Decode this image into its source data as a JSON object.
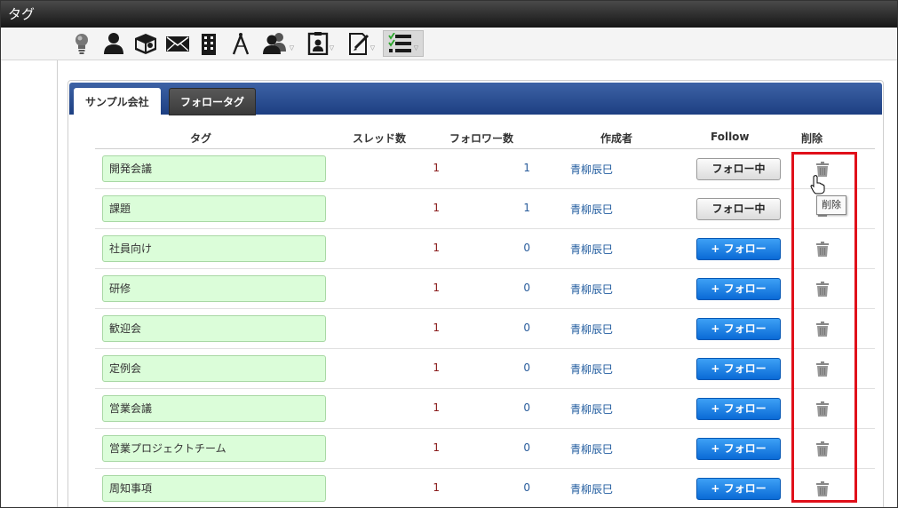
{
  "window": {
    "title": "タグ"
  },
  "toolbar": {
    "icons": [
      {
        "name": "lightbulb-icon"
      },
      {
        "name": "user-icon"
      },
      {
        "name": "package-icon"
      },
      {
        "name": "mail-icon"
      },
      {
        "name": "building-icon"
      },
      {
        "name": "compass-icon"
      },
      {
        "name": "users-icon",
        "dropdown": true
      },
      {
        "name": "clipboard-user-icon",
        "dropdown": true
      },
      {
        "name": "document-edit-icon",
        "dropdown": true
      },
      {
        "name": "checklist-icon",
        "dropdown": true,
        "active": true
      }
    ]
  },
  "tabs": [
    {
      "label": "サンプル会社",
      "active": true
    },
    {
      "label": "フォロータグ",
      "active": false
    }
  ],
  "table": {
    "headers": {
      "tag": "タグ",
      "threads": "スレッド数",
      "followers": "フォロワー数",
      "creator": "作成者",
      "follow": "Follow",
      "delete": "削除"
    },
    "rows": [
      {
        "tag": "開発会議",
        "threads": "1",
        "followers": "1",
        "creator": "青柳辰巳",
        "follow_label": "フォロー中",
        "following": true
      },
      {
        "tag": "課題",
        "threads": "1",
        "followers": "1",
        "creator": "青柳辰巳",
        "follow_label": "フォロー中",
        "following": true
      },
      {
        "tag": "社員向け",
        "threads": "1",
        "followers": "0",
        "creator": "青柳辰巳",
        "follow_label": "+ フォロー",
        "following": false
      },
      {
        "tag": "研修",
        "threads": "1",
        "followers": "0",
        "creator": "青柳辰巳",
        "follow_label": "+ フォロー",
        "following": false
      },
      {
        "tag": "歓迎会",
        "threads": "1",
        "followers": "0",
        "creator": "青柳辰巳",
        "follow_label": "+ フォロー",
        "following": false
      },
      {
        "tag": "定例会",
        "threads": "1",
        "followers": "0",
        "creator": "青柳辰巳",
        "follow_label": "+ フォロー",
        "following": false
      },
      {
        "tag": "営業会議",
        "threads": "1",
        "followers": "0",
        "creator": "青柳辰巳",
        "follow_label": "+ フォロー",
        "following": false
      },
      {
        "tag": "営業プロジェクトチーム",
        "threads": "1",
        "followers": "0",
        "creator": "青柳辰巳",
        "follow_label": "+ フォロー",
        "following": false
      },
      {
        "tag": "周知事項",
        "threads": "1",
        "followers": "0",
        "creator": "青柳辰巳",
        "follow_label": "+ フォロー",
        "following": false
      }
    ]
  },
  "tooltip": {
    "text": "削除"
  },
  "colors": {
    "tabbar": "#2a4e93",
    "follow_button": "#0a78e6",
    "highlight": "#e0101a",
    "tag_background": "#dbfdd9"
  }
}
